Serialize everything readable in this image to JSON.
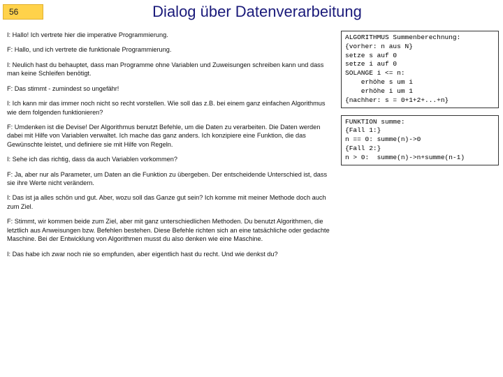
{
  "slide_number": "56",
  "title": "Dialog über Datenverarbeitung",
  "dialog": [
    "I: Hallo! Ich vertrete hier die imperative Programmierung.",
    "F: Hallo, und ich vertrete die funktionale Programmierung.",
    "I: Neulich hast du behauptet, dass man Programme ohne Variablen und Zuweisungen schreiben kann und dass man keine Schleifen benötigt.",
    "F: Das stimmt - zumindest so ungefähr!",
    "I: Ich kann mir das immer noch nicht so recht vorstellen. Wie soll das z.B. bei einem ganz einfachen Algorithmus wie dem folgenden funktionieren?",
    "F: Umdenken ist die Devise! Der Algorithmus benutzt Befehle, um die Daten zu verarbeiten. Die Daten werden dabei mit Hilfe von Variablen verwaltet. Ich mache das ganz anders. Ich konzipiere eine Funktion, die das Gewünschte leistet, und definiere sie mit Hilfe von Regeln.",
    "I: Sehe ich das richtig, dass da auch Variablen vorkommen?",
    "F: Ja, aber nur als Parameter, um Daten an die Funktion zu übergeben. Der entscheidende Unterschied ist, dass sie ihre Werte nicht verändern.",
    "I: Das ist ja alles schön und gut. Aber, wozu soll das Ganze gut sein? Ich komme mit meiner Methode doch auch zum Ziel.",
    "F: Stimmt, wir kommen beide zum Ziel, aber mit ganz unterschiedlichen Methoden. Du benutzt Algorithmen, die letztlich aus Anweisungen bzw. Befehlen bestehen. Diese Befehle richten sich an eine tatsächliche oder gedachte Maschine. Bei der Entwicklung von Algorithmen musst du also denken wie eine Maschine.",
    "I: Das habe ich zwar noch nie so empfunden, aber eigentlich hast du recht. Und wie denkst du?"
  ],
  "code_blocks": [
    "ALGORITHMUS Summenberechnung:\n{vorher: n aus N}\nsetze s auf 0\nsetze i auf 0\nSOLANGE i <= n:\n    erhöhe s um i\n    erhöhe i um 1\n{nachher: s = 0+1+2+...+n}",
    "FUNKTION summe:\n{Fall 1:}\nn == 0: summe(n)->0\n{Fall 2:}\nn > 0:  summe(n)->n+summe(n-1)"
  ]
}
